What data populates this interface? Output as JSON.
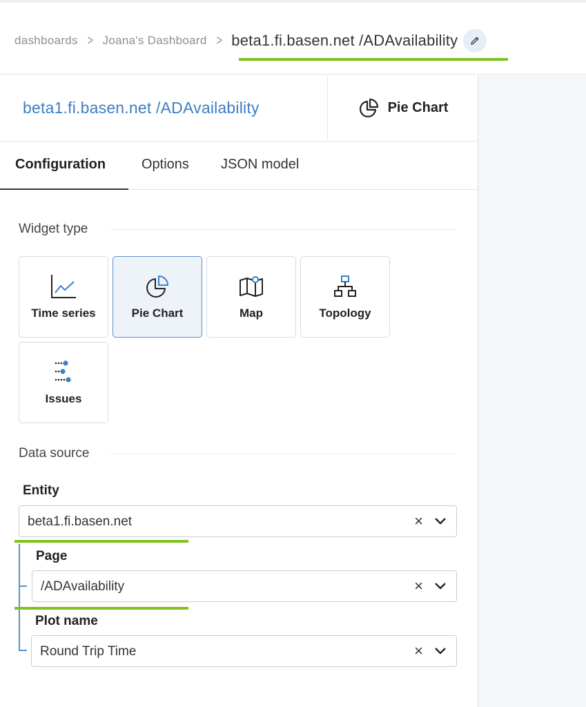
{
  "breadcrumb": {
    "items": [
      "dashboards",
      "Joana's Dashboard"
    ],
    "separator": ">",
    "current": "beta1.fi.basen.net /ADAvailability",
    "edit_icon": "pencil-icon"
  },
  "panel": {
    "title": "beta1.fi.basen.net /ADAvailability",
    "widget_type_label": "Pie Chart",
    "widget_type_icon": "pie-chart-icon"
  },
  "tabs": [
    {
      "label": "Configuration",
      "active": true
    },
    {
      "label": "Options",
      "active": false
    },
    {
      "label": "JSON model",
      "active": false
    }
  ],
  "widget_type": {
    "heading": "Widget type",
    "options": [
      {
        "label": "Time series",
        "icon": "line-chart-icon",
        "selected": false
      },
      {
        "label": "Pie Chart",
        "icon": "pie-chart-icon",
        "selected": true
      },
      {
        "label": "Map",
        "icon": "map-icon",
        "selected": false
      },
      {
        "label": "Topology",
        "icon": "topology-icon",
        "selected": false
      },
      {
        "label": "Issues",
        "icon": "issues-icon",
        "selected": false
      }
    ]
  },
  "data_source": {
    "heading": "Data source",
    "entity": {
      "label": "Entity",
      "value": "beta1.fi.basen.net"
    },
    "page": {
      "label": "Page",
      "value": "/ADAvailability"
    },
    "plot_name": {
      "label": "Plot name",
      "value": "Round Trip Time"
    },
    "clear_glyph": "×"
  },
  "colors": {
    "accent_blue": "#3d7ec4",
    "highlight_green": "#7fc31c",
    "selected_card_bg": "#eef3f9"
  }
}
